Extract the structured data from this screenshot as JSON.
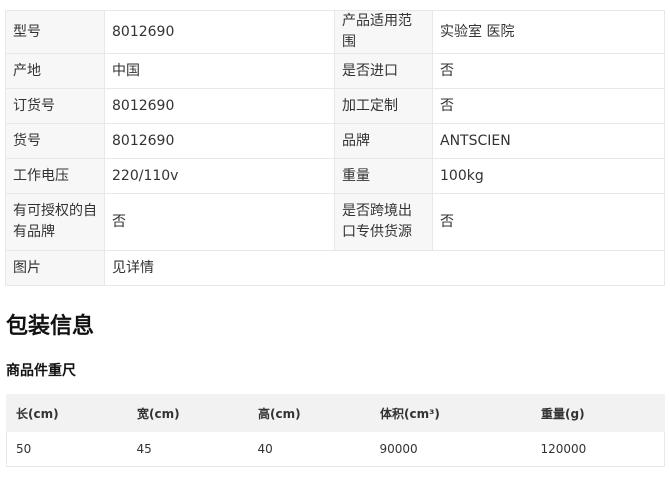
{
  "specs": {
    "rows": [
      {
        "l1": "型号",
        "v1": "8012690",
        "l2": "产品适用范围",
        "v2": "实验室 医院"
      },
      {
        "l1": "产地",
        "v1": "中国",
        "l2": "是否进口",
        "v2": "否"
      },
      {
        "l1": "订货号",
        "v1": "8012690",
        "l2": "加工定制",
        "v2": "否"
      },
      {
        "l1": "货号",
        "v1": "8012690",
        "l2": "品牌",
        "v2": "ANTSCIEN"
      },
      {
        "l1": "工作电压",
        "v1": "220/110v",
        "l2": "重量",
        "v2": "100kg"
      },
      {
        "l1": "有可授权的自有品牌",
        "v1": "否",
        "l2": "是否跨境出口专供货源",
        "v2": "否"
      }
    ],
    "image_row": {
      "label": "图片",
      "value": "见详情"
    }
  },
  "packaging": {
    "title": "包装信息",
    "subtitle": "商品件重尺",
    "headers": [
      "长(cm)",
      "宽(cm)",
      "高(cm)",
      "体积(cm³)",
      "重量(g)"
    ],
    "values": [
      "50",
      "45",
      "40",
      "90000",
      "120000"
    ]
  }
}
